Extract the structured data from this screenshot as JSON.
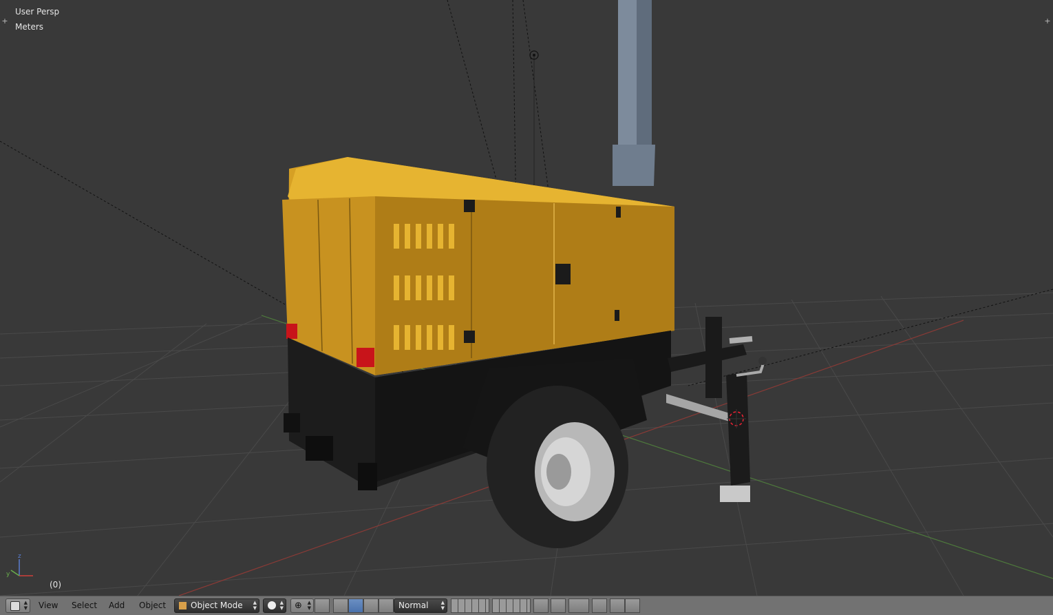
{
  "viewport": {
    "view_name": "User Persp",
    "units": "Meters",
    "frame": "(0)",
    "axis": {
      "x_color": "#d0403a",
      "y_color": "#6ab04c",
      "z_color": "#5a7ed0"
    }
  },
  "header": {
    "editor_type_icon": "3d-view-icon",
    "menus": [
      "View",
      "Select",
      "Add",
      "Object"
    ],
    "mode": "Object Mode",
    "mode_icon": "cube-icon",
    "viewport_shading_icon": "sphere-icon",
    "pivot_icon": "pivot-point-icon",
    "manipulator_icons": [
      "manipulator-toggle-icon",
      "translate-icon",
      "rotate-icon",
      "scale-icon"
    ],
    "transform_orientation": "Normal",
    "layers_icon": "layers-icon",
    "lock_icon": "lock-icon",
    "snap_icons": [
      "proportional-edit-icon",
      "snap-icon"
    ],
    "render_icons": [
      "render-icon",
      "render-anim-icon"
    ]
  },
  "colors": {
    "background": "#393939",
    "header": "#727272",
    "generator_body": "#d6a024",
    "chassis": "#1b1b1b",
    "accent_active": "#5680c2"
  }
}
